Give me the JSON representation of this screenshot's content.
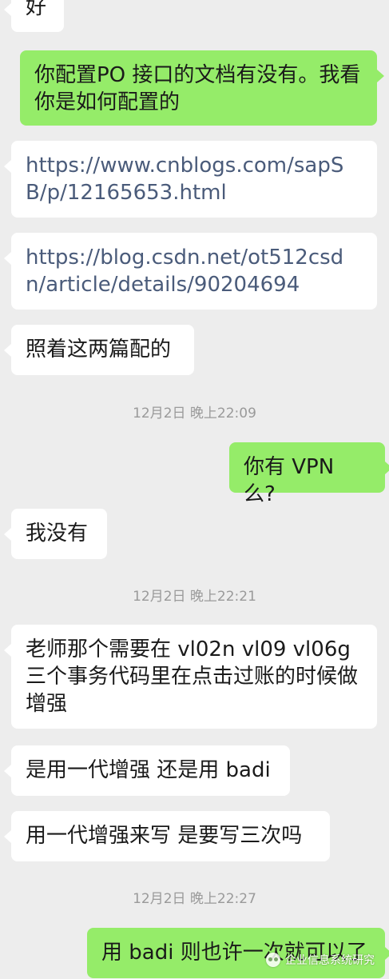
{
  "messages": [
    {
      "id": "m0",
      "side": "in",
      "text": "好"
    },
    {
      "id": "m1",
      "side": "out",
      "text": "你配置PO 接口的文档有没有。我看你是如何配置的"
    },
    {
      "id": "m2",
      "side": "in",
      "text": "https://www.cnblogs.com/sapSB/p/12165653.html"
    },
    {
      "id": "m3",
      "side": "in",
      "text": "https://blog.csdn.net/ot512csdn/article/details/90204694"
    },
    {
      "id": "m4",
      "side": "in",
      "text": "照着这两篇配的"
    },
    {
      "id": "t1",
      "side": "time",
      "text": "12月2日 晚上22:09"
    },
    {
      "id": "m5",
      "side": "out",
      "text": "你有 VPN 么?"
    },
    {
      "id": "m6",
      "side": "in",
      "text": "我没有"
    },
    {
      "id": "t2",
      "side": "time",
      "text": "12月2日 晚上22:21"
    },
    {
      "id": "m7",
      "side": "in",
      "text": "老师那个需要在 vl02n vl09 vl06g 三个事务代码里在点击过账的时候做增强"
    },
    {
      "id": "m8",
      "side": "in",
      "text": "是用一代增强 还是用 badi"
    },
    {
      "id": "m9",
      "side": "in",
      "text": "用一代增强来写 是要写三次吗"
    },
    {
      "id": "t3",
      "side": "time",
      "text": "12月2日 晚上22:27"
    },
    {
      "id": "m10",
      "side": "out",
      "text": "用 badi 则也许一次就可以了"
    }
  ],
  "watermark": {
    "text": "企业信息系统研究",
    "icon": "wechat-logo-icon"
  },
  "colors": {
    "background": "#ededed",
    "incoming_bubble": "#ffffff",
    "outgoing_bubble": "#95ec69",
    "link_text": "#4a5b7a",
    "timestamp": "#9a9a9a"
  }
}
